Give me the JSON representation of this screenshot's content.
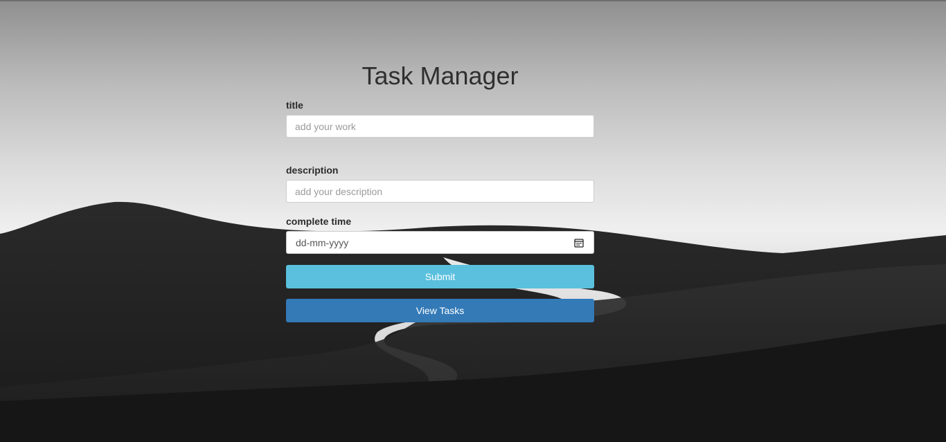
{
  "app": {
    "title": "Task Manager"
  },
  "form": {
    "title_label": "title",
    "title_placeholder": "add your work",
    "description_label": "description",
    "description_placeholder": "add your description",
    "time_label": "complete time",
    "time_value": "dd-mm-yyyy",
    "submit_label": "Submit",
    "view_label": "View Tasks"
  },
  "colors": {
    "submit": "#5bc0de",
    "view": "#337ab7"
  },
  "icons": {
    "date": "calendar-icon"
  }
}
